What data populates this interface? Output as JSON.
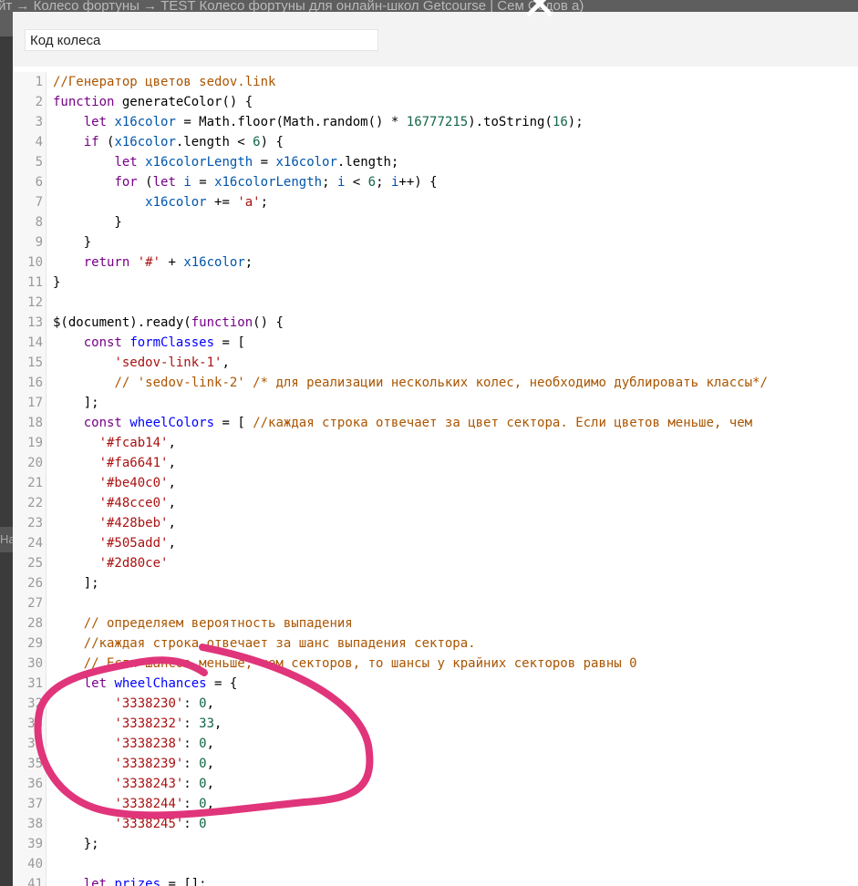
{
  "backdrop": {
    "breadcrumb": "йт → Колесо фортуны → TEST Колесо фортуны для онлайн-школ Getcourse | Сем Седов а)",
    "side_labels": [
      "На"
    ]
  },
  "dialog": {
    "title_value": "Код колеса",
    "close_glyph": "✕"
  },
  "editor": {
    "lines": [
      {
        "n": "1",
        "tokens": [
          {
            "t": "//Генератор цветов sedov.link",
            "c": "comment"
          }
        ]
      },
      {
        "n": "2",
        "tokens": [
          {
            "t": "function",
            "c": "keyword"
          },
          {
            "t": " generateColor() {",
            "c": "plain"
          }
        ]
      },
      {
        "n": "3",
        "tokens": [
          {
            "t": "    ",
            "c": "plain"
          },
          {
            "t": "let",
            "c": "keyword"
          },
          {
            "t": " ",
            "c": "plain"
          },
          {
            "t": "x16color",
            "c": "var"
          },
          {
            "t": " = Math.floor(Math.random() * ",
            "c": "plain"
          },
          {
            "t": "16777215",
            "c": "number"
          },
          {
            "t": ").toString(",
            "c": "plain"
          },
          {
            "t": "16",
            "c": "number"
          },
          {
            "t": ");",
            "c": "plain"
          }
        ]
      },
      {
        "n": "4",
        "tokens": [
          {
            "t": "    ",
            "c": "plain"
          },
          {
            "t": "if",
            "c": "keyword"
          },
          {
            "t": " (",
            "c": "plain"
          },
          {
            "t": "x16color",
            "c": "var"
          },
          {
            "t": ".length < ",
            "c": "plain"
          },
          {
            "t": "6",
            "c": "number"
          },
          {
            "t": ") {",
            "c": "plain"
          }
        ]
      },
      {
        "n": "5",
        "tokens": [
          {
            "t": "        ",
            "c": "plain"
          },
          {
            "t": "let",
            "c": "keyword"
          },
          {
            "t": " ",
            "c": "plain"
          },
          {
            "t": "x16colorLength",
            "c": "var"
          },
          {
            "t": " = ",
            "c": "plain"
          },
          {
            "t": "x16color",
            "c": "var"
          },
          {
            "t": ".length;",
            "c": "plain"
          }
        ]
      },
      {
        "n": "6",
        "tokens": [
          {
            "t": "        ",
            "c": "plain"
          },
          {
            "t": "for",
            "c": "keyword"
          },
          {
            "t": " (",
            "c": "plain"
          },
          {
            "t": "let",
            "c": "keyword"
          },
          {
            "t": " ",
            "c": "plain"
          },
          {
            "t": "i",
            "c": "var"
          },
          {
            "t": " = ",
            "c": "plain"
          },
          {
            "t": "x16colorLength",
            "c": "var"
          },
          {
            "t": "; ",
            "c": "plain"
          },
          {
            "t": "i",
            "c": "var"
          },
          {
            "t": " < ",
            "c": "plain"
          },
          {
            "t": "6",
            "c": "number"
          },
          {
            "t": "; ",
            "c": "plain"
          },
          {
            "t": "i",
            "c": "var"
          },
          {
            "t": "++) {",
            "c": "plain"
          }
        ]
      },
      {
        "n": "7",
        "tokens": [
          {
            "t": "            ",
            "c": "plain"
          },
          {
            "t": "x16color",
            "c": "var"
          },
          {
            "t": " += ",
            "c": "plain"
          },
          {
            "t": "'a'",
            "c": "string"
          },
          {
            "t": ";",
            "c": "plain"
          }
        ]
      },
      {
        "n": "8",
        "tokens": [
          {
            "t": "        }",
            "c": "plain"
          }
        ]
      },
      {
        "n": "9",
        "tokens": [
          {
            "t": "    }",
            "c": "plain"
          }
        ]
      },
      {
        "n": "10",
        "tokens": [
          {
            "t": "    ",
            "c": "plain"
          },
          {
            "t": "return",
            "c": "keyword"
          },
          {
            "t": " ",
            "c": "plain"
          },
          {
            "t": "'#'",
            "c": "string"
          },
          {
            "t": " + ",
            "c": "plain"
          },
          {
            "t": "x16color",
            "c": "var"
          },
          {
            "t": ";",
            "c": "plain"
          }
        ]
      },
      {
        "n": "11",
        "tokens": [
          {
            "t": "}",
            "c": "plain"
          }
        ]
      },
      {
        "n": "12",
        "tokens": [
          {
            "t": "",
            "c": "plain"
          }
        ]
      },
      {
        "n": "13",
        "tokens": [
          {
            "t": "$(document).ready(",
            "c": "plain"
          },
          {
            "t": "function",
            "c": "keyword"
          },
          {
            "t": "() {",
            "c": "plain"
          }
        ]
      },
      {
        "n": "14",
        "tokens": [
          {
            "t": "    ",
            "c": "plain"
          },
          {
            "t": "const",
            "c": "keyword"
          },
          {
            "t": " ",
            "c": "plain"
          },
          {
            "t": "formClasses",
            "c": "def"
          },
          {
            "t": " = [",
            "c": "plain"
          }
        ]
      },
      {
        "n": "15",
        "tokens": [
          {
            "t": "        ",
            "c": "plain"
          },
          {
            "t": "'sedov-link-1'",
            "c": "string"
          },
          {
            "t": ",",
            "c": "plain"
          }
        ]
      },
      {
        "n": "16",
        "tokens": [
          {
            "t": "        ",
            "c": "plain"
          },
          {
            "t": "// 'sedov-link-2' /* для реализации нескольких колес, необходимо дублировать классы*/",
            "c": "comment"
          }
        ]
      },
      {
        "n": "17",
        "tokens": [
          {
            "t": "    ];",
            "c": "plain"
          }
        ]
      },
      {
        "n": "18",
        "tokens": [
          {
            "t": "    ",
            "c": "plain"
          },
          {
            "t": "const",
            "c": "keyword"
          },
          {
            "t": " ",
            "c": "plain"
          },
          {
            "t": "wheelColors",
            "c": "def"
          },
          {
            "t": " = [ ",
            "c": "plain"
          },
          {
            "t": "//каждая строка отвечает за цвет сектора. Если цветов меньше, чем",
            "c": "comment"
          }
        ]
      },
      {
        "n": "19",
        "tokens": [
          {
            "t": "      ",
            "c": "plain"
          },
          {
            "t": "'#fcab14'",
            "c": "string"
          },
          {
            "t": ",",
            "c": "plain"
          }
        ]
      },
      {
        "n": "20",
        "tokens": [
          {
            "t": "      ",
            "c": "plain"
          },
          {
            "t": "'#fa6641'",
            "c": "string"
          },
          {
            "t": ",",
            "c": "plain"
          }
        ]
      },
      {
        "n": "21",
        "tokens": [
          {
            "t": "      ",
            "c": "plain"
          },
          {
            "t": "'#be40c0'",
            "c": "string"
          },
          {
            "t": ",",
            "c": "plain"
          }
        ]
      },
      {
        "n": "22",
        "tokens": [
          {
            "t": "      ",
            "c": "plain"
          },
          {
            "t": "'#48cce0'",
            "c": "string"
          },
          {
            "t": ",",
            "c": "plain"
          }
        ]
      },
      {
        "n": "23",
        "tokens": [
          {
            "t": "      ",
            "c": "plain"
          },
          {
            "t": "'#428beb'",
            "c": "string"
          },
          {
            "t": ",",
            "c": "plain"
          }
        ]
      },
      {
        "n": "24",
        "tokens": [
          {
            "t": "      ",
            "c": "plain"
          },
          {
            "t": "'#505add'",
            "c": "string"
          },
          {
            "t": ",",
            "c": "plain"
          }
        ]
      },
      {
        "n": "25",
        "tokens": [
          {
            "t": "      ",
            "c": "plain"
          },
          {
            "t": "'#2d80ce'",
            "c": "string"
          }
        ]
      },
      {
        "n": "26",
        "tokens": [
          {
            "t": "    ];",
            "c": "plain"
          }
        ]
      },
      {
        "n": "27",
        "tokens": [
          {
            "t": "",
            "c": "plain"
          }
        ]
      },
      {
        "n": "28",
        "tokens": [
          {
            "t": "    ",
            "c": "plain"
          },
          {
            "t": "// определяем вероятность выпадения",
            "c": "comment"
          }
        ]
      },
      {
        "n": "29",
        "tokens": [
          {
            "t": "    ",
            "c": "plain"
          },
          {
            "t": "//каждая строка отвечает за шанс выпадения сектора.",
            "c": "comment"
          }
        ]
      },
      {
        "n": "30",
        "tokens": [
          {
            "t": "    ",
            "c": "plain"
          },
          {
            "t": "// Если шансов меньше, чем секторов, то шансы у крайних секторов равны 0",
            "c": "comment"
          }
        ]
      },
      {
        "n": "31",
        "tokens": [
          {
            "t": "    ",
            "c": "plain"
          },
          {
            "t": "let",
            "c": "keyword"
          },
          {
            "t": " ",
            "c": "plain"
          },
          {
            "t": "wheelChances",
            "c": "def"
          },
          {
            "t": " = {",
            "c": "plain"
          }
        ]
      },
      {
        "n": "32",
        "tokens": [
          {
            "t": "        ",
            "c": "plain"
          },
          {
            "t": "'3338230'",
            "c": "string"
          },
          {
            "t": ": ",
            "c": "plain"
          },
          {
            "t": "0",
            "c": "number"
          },
          {
            "t": ",",
            "c": "plain"
          }
        ]
      },
      {
        "n": "33",
        "tokens": [
          {
            "t": "        ",
            "c": "plain"
          },
          {
            "t": "'3338232'",
            "c": "string"
          },
          {
            "t": ": ",
            "c": "plain"
          },
          {
            "t": "33",
            "c": "number"
          },
          {
            "t": ",",
            "c": "plain"
          }
        ]
      },
      {
        "n": "34",
        "tokens": [
          {
            "t": "        ",
            "c": "plain"
          },
          {
            "t": "'3338238'",
            "c": "string"
          },
          {
            "t": ": ",
            "c": "plain"
          },
          {
            "t": "0",
            "c": "number"
          },
          {
            "t": ",",
            "c": "plain"
          }
        ]
      },
      {
        "n": "35",
        "tokens": [
          {
            "t": "        ",
            "c": "plain"
          },
          {
            "t": "'3338239'",
            "c": "string"
          },
          {
            "t": ": ",
            "c": "plain"
          },
          {
            "t": "0",
            "c": "number"
          },
          {
            "t": ",",
            "c": "plain"
          }
        ]
      },
      {
        "n": "36",
        "tokens": [
          {
            "t": "        ",
            "c": "plain"
          },
          {
            "t": "'3338243'",
            "c": "string"
          },
          {
            "t": ": ",
            "c": "plain"
          },
          {
            "t": "0",
            "c": "number"
          },
          {
            "t": ",",
            "c": "plain"
          }
        ]
      },
      {
        "n": "37",
        "tokens": [
          {
            "t": "        ",
            "c": "plain"
          },
          {
            "t": "'3338244'",
            "c": "string"
          },
          {
            "t": ": ",
            "c": "plain"
          },
          {
            "t": "0",
            "c": "number"
          },
          {
            "t": ",",
            "c": "plain"
          }
        ]
      },
      {
        "n": "38",
        "tokens": [
          {
            "t": "        ",
            "c": "plain"
          },
          {
            "t": "'3338245'",
            "c": "string"
          },
          {
            "t": ": ",
            "c": "plain"
          },
          {
            "t": "0",
            "c": "number"
          }
        ]
      },
      {
        "n": "39",
        "tokens": [
          {
            "t": "    };",
            "c": "plain"
          }
        ]
      },
      {
        "n": "40",
        "tokens": [
          {
            "t": "",
            "c": "plain"
          }
        ]
      },
      {
        "n": "41",
        "tokens": [
          {
            "t": "    ",
            "c": "plain"
          },
          {
            "t": "let",
            "c": "keyword"
          },
          {
            "t": " ",
            "c": "plain"
          },
          {
            "t": "prizes",
            "c": "def"
          },
          {
            "t": " = [];",
            "c": "plain"
          }
        ]
      }
    ]
  },
  "colors": {
    "annotation_stroke": "#e0357a",
    "comment": "#aa5500",
    "keyword": "#770088",
    "string": "#aa1111",
    "number": "#116644"
  }
}
